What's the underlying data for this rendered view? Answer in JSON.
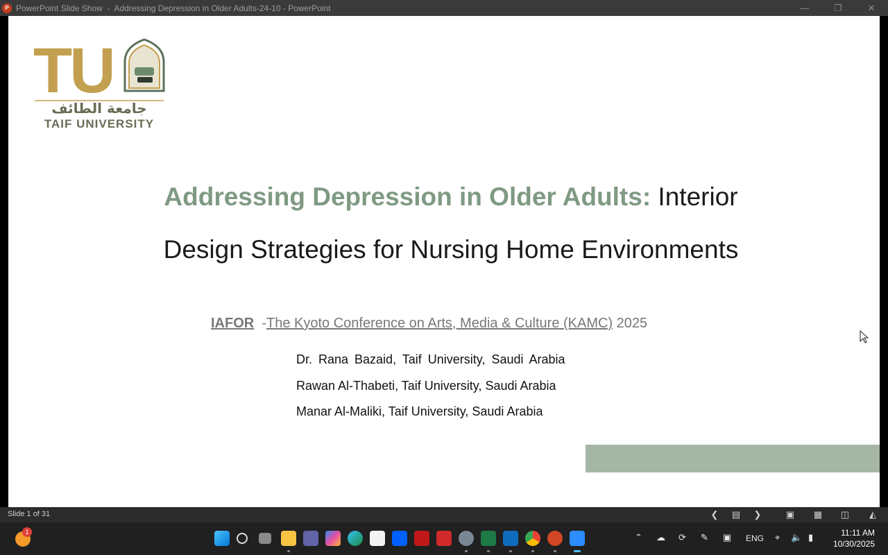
{
  "window": {
    "app_badge": "P",
    "title": "PowerPoint Slide Show  -  Addressing Depression in Older Adults-24-10 - PowerPoint",
    "minimize_icon": "minimize-icon",
    "restore_icon": "restore-icon",
    "close_icon": "close-icon"
  },
  "slide": {
    "logo": {
      "letters": "TU",
      "arabic_name": "جامعة الطائف",
      "english_name": "TAIF UNIVERSITY",
      "gold": "#c2a04f"
    },
    "title_accent": "Addressing Depression in Older Adults:",
    "title_rest": " Interior",
    "title_line2": "Design Strategies for Nursing Home Environments",
    "conference_org": "IAFOR",
    "conference_dash": "  -",
    "conference_name": "The Kyoto Conference on Arts, Media & Culture (KAMC)",
    "conference_year": " 2025",
    "authors": [
      "Dr. Rana Bazaid, Taif University, Saudi Arabia",
      "Rawan Al-Thabeti, Taif University, Saudi Arabia",
      "Manar Al-Maliki, Taif University, Saudi Arabia"
    ],
    "accent_color": "#7f9a83",
    "bar_color": "#a5b6a5"
  },
  "statusbar": {
    "slide_counter": "Slide 1 of 31",
    "icons": [
      "previous-icon",
      "slide-notes-icon",
      "next-icon",
      "normal-view-icon",
      "slide-sorter-icon",
      "reading-view-icon",
      "slide-show-icon"
    ]
  },
  "taskbar": {
    "notification_count": "1",
    "apps": [
      "start-icon",
      "search-icon",
      "task-view-icon",
      "file-explorer-icon",
      "teams-icon",
      "copilot-icon",
      "edge-icon",
      "store-icon",
      "dropbox-icon",
      "mcafee-icon",
      "app-icon",
      "settings-icon",
      "excel-icon",
      "outlook-icon",
      "chrome-icon",
      "powerpoint-icon",
      "zoom-icon"
    ],
    "tray": {
      "language": "ENG",
      "time": "11:11 AM",
      "date": "10/30/2025"
    }
  }
}
